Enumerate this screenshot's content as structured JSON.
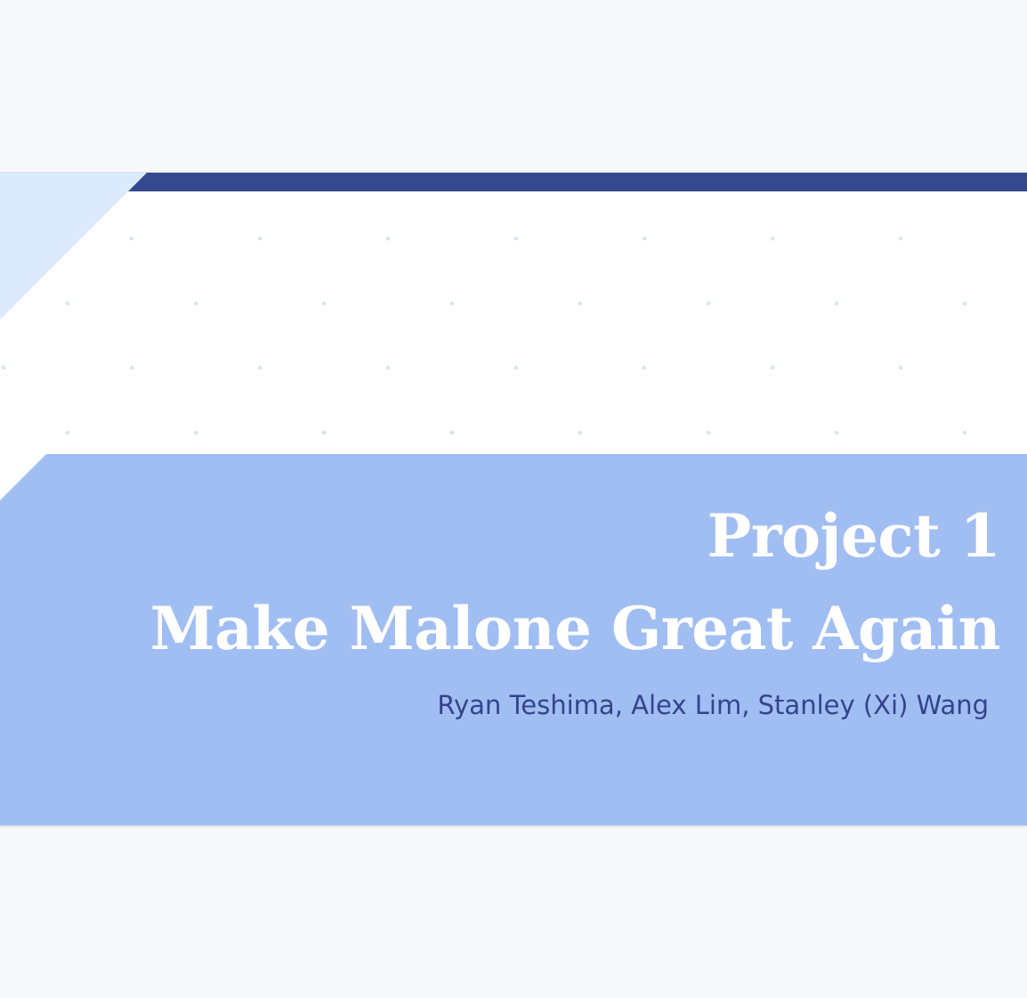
{
  "slide": {
    "title_line_1": "Project 1",
    "title_line_2": "Make Malone Great Again",
    "authors": "Ryan Teshima, Alex Lim, Stanley (Xi) Wang"
  },
  "colors": {
    "background": "#f7f8fa",
    "top_bar": "#354a8e",
    "band": "#a1bef3",
    "corner_triangle": "#dcebfc",
    "dots": "#cfe3fb",
    "title_text": "#ffffff",
    "author_text": "#33448c"
  }
}
